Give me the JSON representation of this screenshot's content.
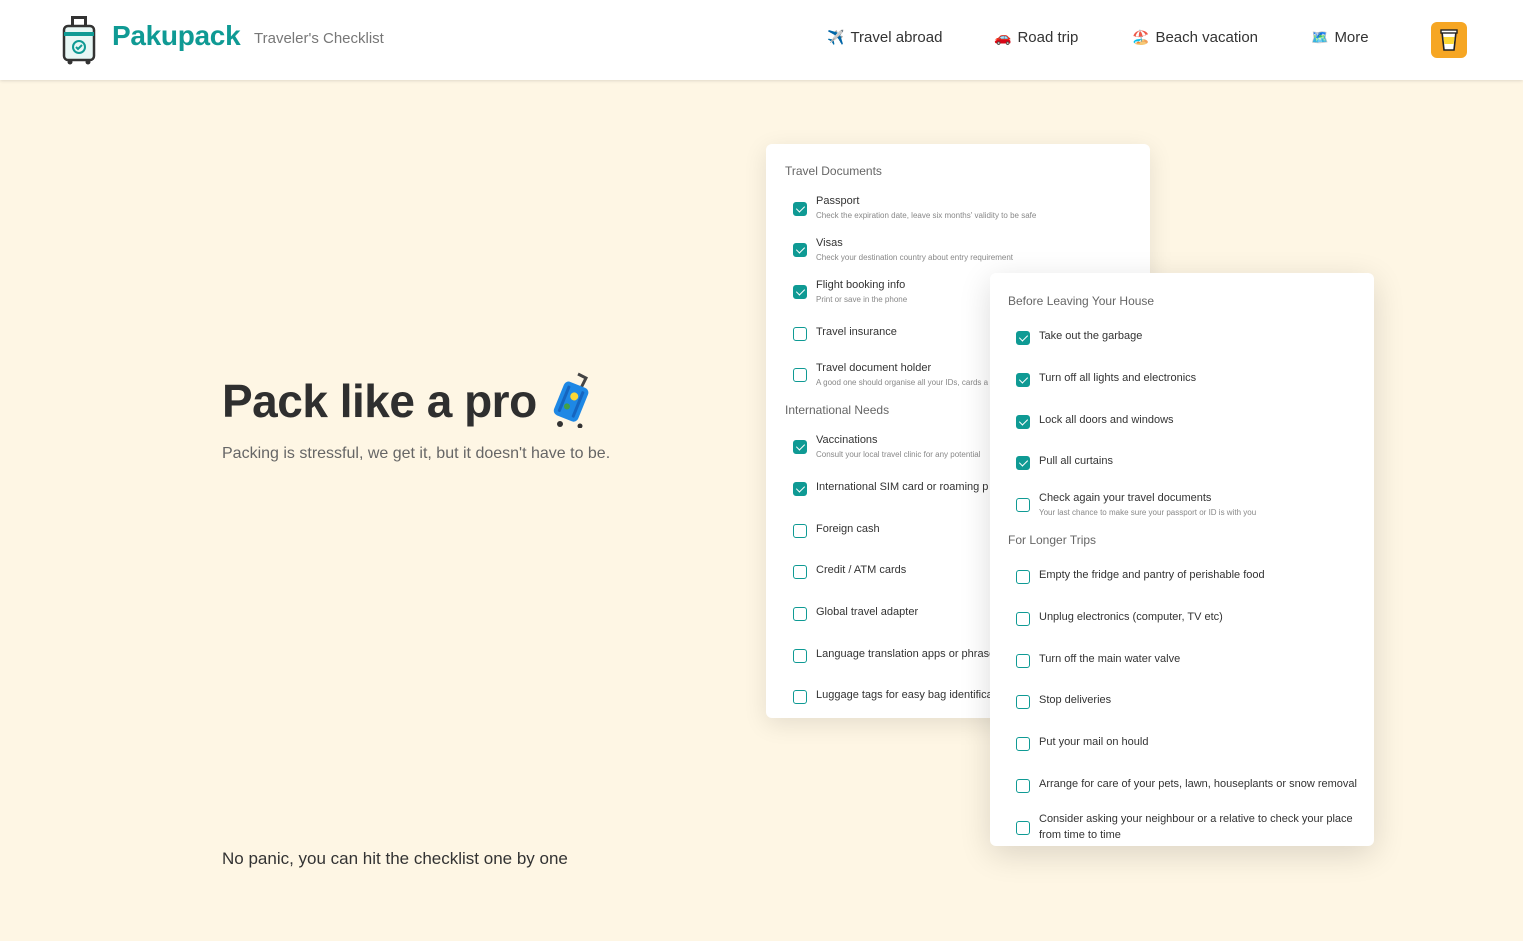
{
  "header": {
    "brand": "Pakupack",
    "tagline": "Traveler's Checklist",
    "nav": [
      {
        "icon": "✈️",
        "label": "Travel abroad"
      },
      {
        "icon": "🚗",
        "label": "Road trip"
      },
      {
        "icon": "🏖️",
        "label": "Beach vacation"
      },
      {
        "icon": "🗺️",
        "label": "More"
      }
    ],
    "coffee_icon": "coffee-cup-icon"
  },
  "hero": {
    "title": "Pack like a pro",
    "subtitle": "Packing is stressful, we get it, but it doesn't have to be."
  },
  "footer_note": "No panic, you can hit the checklist one by one",
  "card1": {
    "sections": [
      {
        "title": "Travel Documents",
        "items": [
          {
            "label": "Passport",
            "desc": "Check the expiration date, leave six months' validity to be safe",
            "checked": true
          },
          {
            "label": "Visas",
            "desc": "Check your destination country about entry requirement",
            "checked": true
          },
          {
            "label": "Flight booking info",
            "desc": "Print or save in the phone",
            "checked": true
          },
          {
            "label": "Travel insurance",
            "desc": "",
            "checked": false
          },
          {
            "label": "Travel document holder",
            "desc": "A good one should organise all your IDs, cards a",
            "checked": false
          }
        ]
      },
      {
        "title": "International Needs",
        "items": [
          {
            "label": "Vaccinations",
            "desc": "Consult your local travel clinic for any potential",
            "checked": true
          },
          {
            "label": "International SIM card or roaming p",
            "desc": "",
            "checked": true
          },
          {
            "label": "Foreign cash",
            "desc": "",
            "checked": false
          },
          {
            "label": "Credit / ATM cards",
            "desc": "",
            "checked": false
          },
          {
            "label": "Global travel adapter",
            "desc": "",
            "checked": false
          },
          {
            "label": "Language translation apps or phrase",
            "desc": "",
            "checked": false
          },
          {
            "label": "Luggage tags for easy bag identifica",
            "desc": "",
            "checked": false
          }
        ]
      }
    ]
  },
  "card2": {
    "sections": [
      {
        "title": "Before Leaving Your House",
        "items": [
          {
            "label": "Take out the garbage",
            "desc": "",
            "checked": true
          },
          {
            "label": "Turn off all lights and electronics",
            "desc": "",
            "checked": true
          },
          {
            "label": "Lock all doors and windows",
            "desc": "",
            "checked": true
          },
          {
            "label": "Pull all curtains",
            "desc": "",
            "checked": true
          },
          {
            "label": "Check again your travel documents",
            "desc": "Your last chance to make sure your passport or ID is with you",
            "checked": false
          }
        ]
      },
      {
        "title": "For Longer Trips",
        "items": [
          {
            "label": "Empty the fridge and pantry of perishable food",
            "desc": "",
            "checked": false
          },
          {
            "label": "Unplug electronics (computer, TV etc)",
            "desc": "",
            "checked": false
          },
          {
            "label": "Turn off the main water valve",
            "desc": "",
            "checked": false
          },
          {
            "label": "Stop deliveries",
            "desc": "",
            "checked": false
          },
          {
            "label": "Put your mail on hould",
            "desc": "",
            "checked": false
          },
          {
            "label": "Arrange for care of your pets, lawn, houseplants or snow removal",
            "desc": "",
            "checked": false
          },
          {
            "label": "Consider asking your neighbour or a relative to check your place from time to time",
            "desc": "",
            "checked": false
          }
        ]
      }
    ]
  },
  "colors": {
    "accent": "#0f9a94",
    "background": "#fef6e4",
    "coffee": "#f6a623"
  }
}
